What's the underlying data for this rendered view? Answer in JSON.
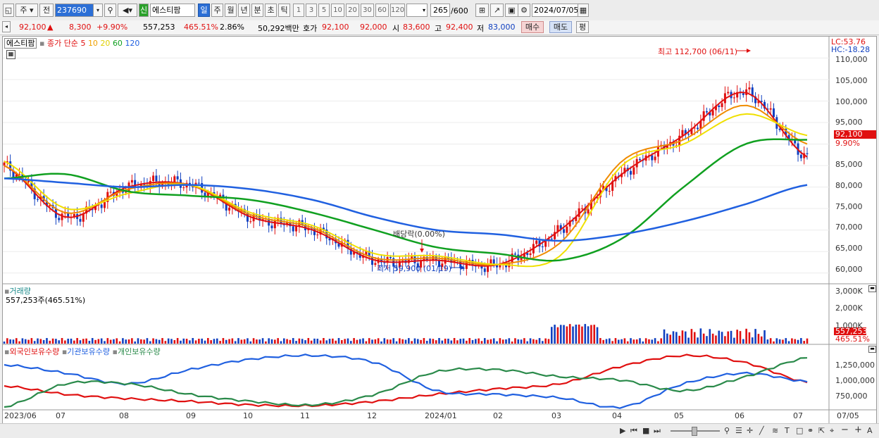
{
  "toolbar": {
    "type_label": "주",
    "prev_label": "전",
    "code": "237690",
    "badge": "신",
    "name": "에스티팜",
    "periods": [
      "일",
      "주",
      "월",
      "년",
      "분",
      "초",
      "틱"
    ],
    "selected_period": "일",
    "mins": [
      "1",
      "3",
      "5",
      "10",
      "20",
      "30",
      "60",
      "120"
    ],
    "count": "265",
    "count_total": "/600",
    "date": "2024/07/05"
  },
  "quote": {
    "price": "92,100",
    "change": "8,300",
    "rate": "+9.90%",
    "volume": "557,253",
    "vol_ratio": "465.51%",
    "turnover": "2.86%",
    "amount": "50,292백만",
    "bid_label": "호가",
    "bid": "92,100",
    "ask": "92,000",
    "open_label": "시",
    "open": "83,600",
    "high_label": "고",
    "high": "92,400",
    "low_label": "저",
    "low": "83,000",
    "buy_label": "매수",
    "sell_label": "매도",
    "eval_label": "평"
  },
  "price_panel": {
    "stock_tag": "에스티팜",
    "ma_label": "종가 단순",
    "ma_periods": [
      "5",
      "10",
      "20",
      "60",
      "120"
    ],
    "lc": "LC:53.76",
    "hc": "HC:-18.28",
    "high_note": "최고 112,700 (06/11)",
    "low_note": "최저 59,900 (01/19)",
    "ratio_note": "배당락(0.00%)",
    "last_price": "92,100",
    "last_rate": "9.90%",
    "y_ticks": [
      "110,000",
      "105,000",
      "100,000",
      "95,000",
      "90,000",
      "85,000",
      "80,000",
      "75,000",
      "70,000",
      "65,000",
      "60,000"
    ]
  },
  "volume_panel": {
    "title": "거래량",
    "value": "557,253주(465.51%)",
    "y_ticks": [
      "3,000K",
      "2,000K",
      "1,000K"
    ],
    "last_volume": "557,253",
    "last_rate": "465.51%"
  },
  "holdings_panel": {
    "series": [
      "외국인보유수량",
      "기관보유수량",
      "개인보유수량"
    ],
    "y_ticks": [
      "1,250,000",
      "1,000,000",
      "750,000"
    ]
  },
  "x_labels": [
    "2023/06",
    "07",
    "08",
    "09",
    "10",
    "11",
    "12",
    "2024/01",
    "02",
    "03",
    "04",
    "05",
    "06",
    "07",
    "07/05"
  ],
  "colors": {
    "ma5": "#e01010",
    "ma10": "#f08c00",
    "ma20": "#f0e000",
    "ma60": "#10a020",
    "ma120": "#2060e0",
    "up": "#e01010",
    "down": "#1040c0"
  },
  "chart_data": {
    "type": "line",
    "title": "에스티팜",
    "x": [
      "2023/06",
      "07",
      "08",
      "09",
      "10",
      "11",
      "12",
      "2024/01",
      "02",
      "03",
      "04",
      "05",
      "06",
      "07"
    ],
    "series": [
      {
        "name": "5",
        "values": [
          85000,
          73000,
          80000,
          80500,
          73000,
          70000,
          63000,
          63000,
          62000,
          70000,
          83000,
          92000,
          102000,
          87000
        ]
      },
      {
        "name": "10",
        "values": [
          85000,
          74000,
          79500,
          80500,
          73500,
          70500,
          63500,
          63500,
          62000,
          67000,
          86000,
          91000,
          99000,
          90000
        ]
      },
      {
        "name": "20",
        "values": [
          86000,
          75000,
          78500,
          80500,
          74000,
          71000,
          64500,
          64000,
          62000,
          64000,
          85000,
          90000,
          97000,
          92000
        ]
      },
      {
        "name": "60",
        "values": [
          82000,
          83000,
          79000,
          78000,
          77000,
          74000,
          70000,
          66000,
          64500,
          63000,
          68000,
          80000,
          90000,
          91000
        ]
      },
      {
        "name": "120",
        "values": [
          82000,
          81000,
          80000,
          80500,
          79500,
          77000,
          73000,
          70000,
          69000,
          67500,
          69000,
          72000,
          76000,
          80500
        ]
      }
    ],
    "ylim": [
      58000,
      114000
    ]
  }
}
